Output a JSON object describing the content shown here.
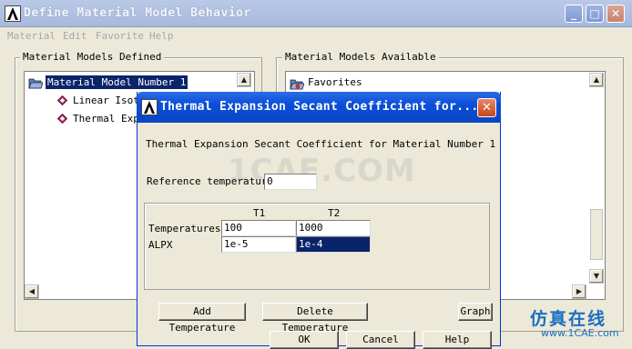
{
  "main_window": {
    "title": "Define Material Model Behavior",
    "controls": {
      "minimize": "_",
      "maximize": "□",
      "close": "✕"
    },
    "menu": [
      "Material",
      "Edit",
      "Favorite",
      "Help"
    ]
  },
  "left_panel": {
    "label": "Material Models Defined",
    "tree": {
      "root": "Material Model Number 1",
      "children": [
        "Linear Isot",
        "Thermal Exp"
      ]
    }
  },
  "right_panel": {
    "label": "Material Models Available",
    "items": [
      "Favorites"
    ]
  },
  "dialog": {
    "title": "Thermal Expansion Secant Coefficient for...",
    "close": "✕",
    "heading": "Thermal Expansion Secant Coefficient for Material Number 1",
    "reference_temperature": {
      "label": "Reference temperature",
      "value": "0"
    },
    "table": {
      "columns": [
        "T1",
        "T2"
      ],
      "rows": [
        {
          "label": "Temperatures",
          "values": [
            "100",
            "1000"
          ]
        },
        {
          "label": "ALPX",
          "values": [
            "1e-5",
            "1e-4"
          ]
        }
      ]
    },
    "buttons": {
      "add_temperature": "Add Temperature",
      "delete_temperature": "Delete Temperature",
      "graph": "Graph",
      "ok": "OK",
      "cancel": "Cancel",
      "help": "Help"
    }
  },
  "watermark": {
    "text": "1CAE.COM"
  },
  "branding": {
    "chinese": "仿真在线",
    "url": "www.1CAE.com"
  },
  "colors": {
    "selection": "#0a246a",
    "dialog_title": "#0b4fd8",
    "main_title_inactive": "#a8b9dc",
    "brand": "#1b6fc2"
  }
}
